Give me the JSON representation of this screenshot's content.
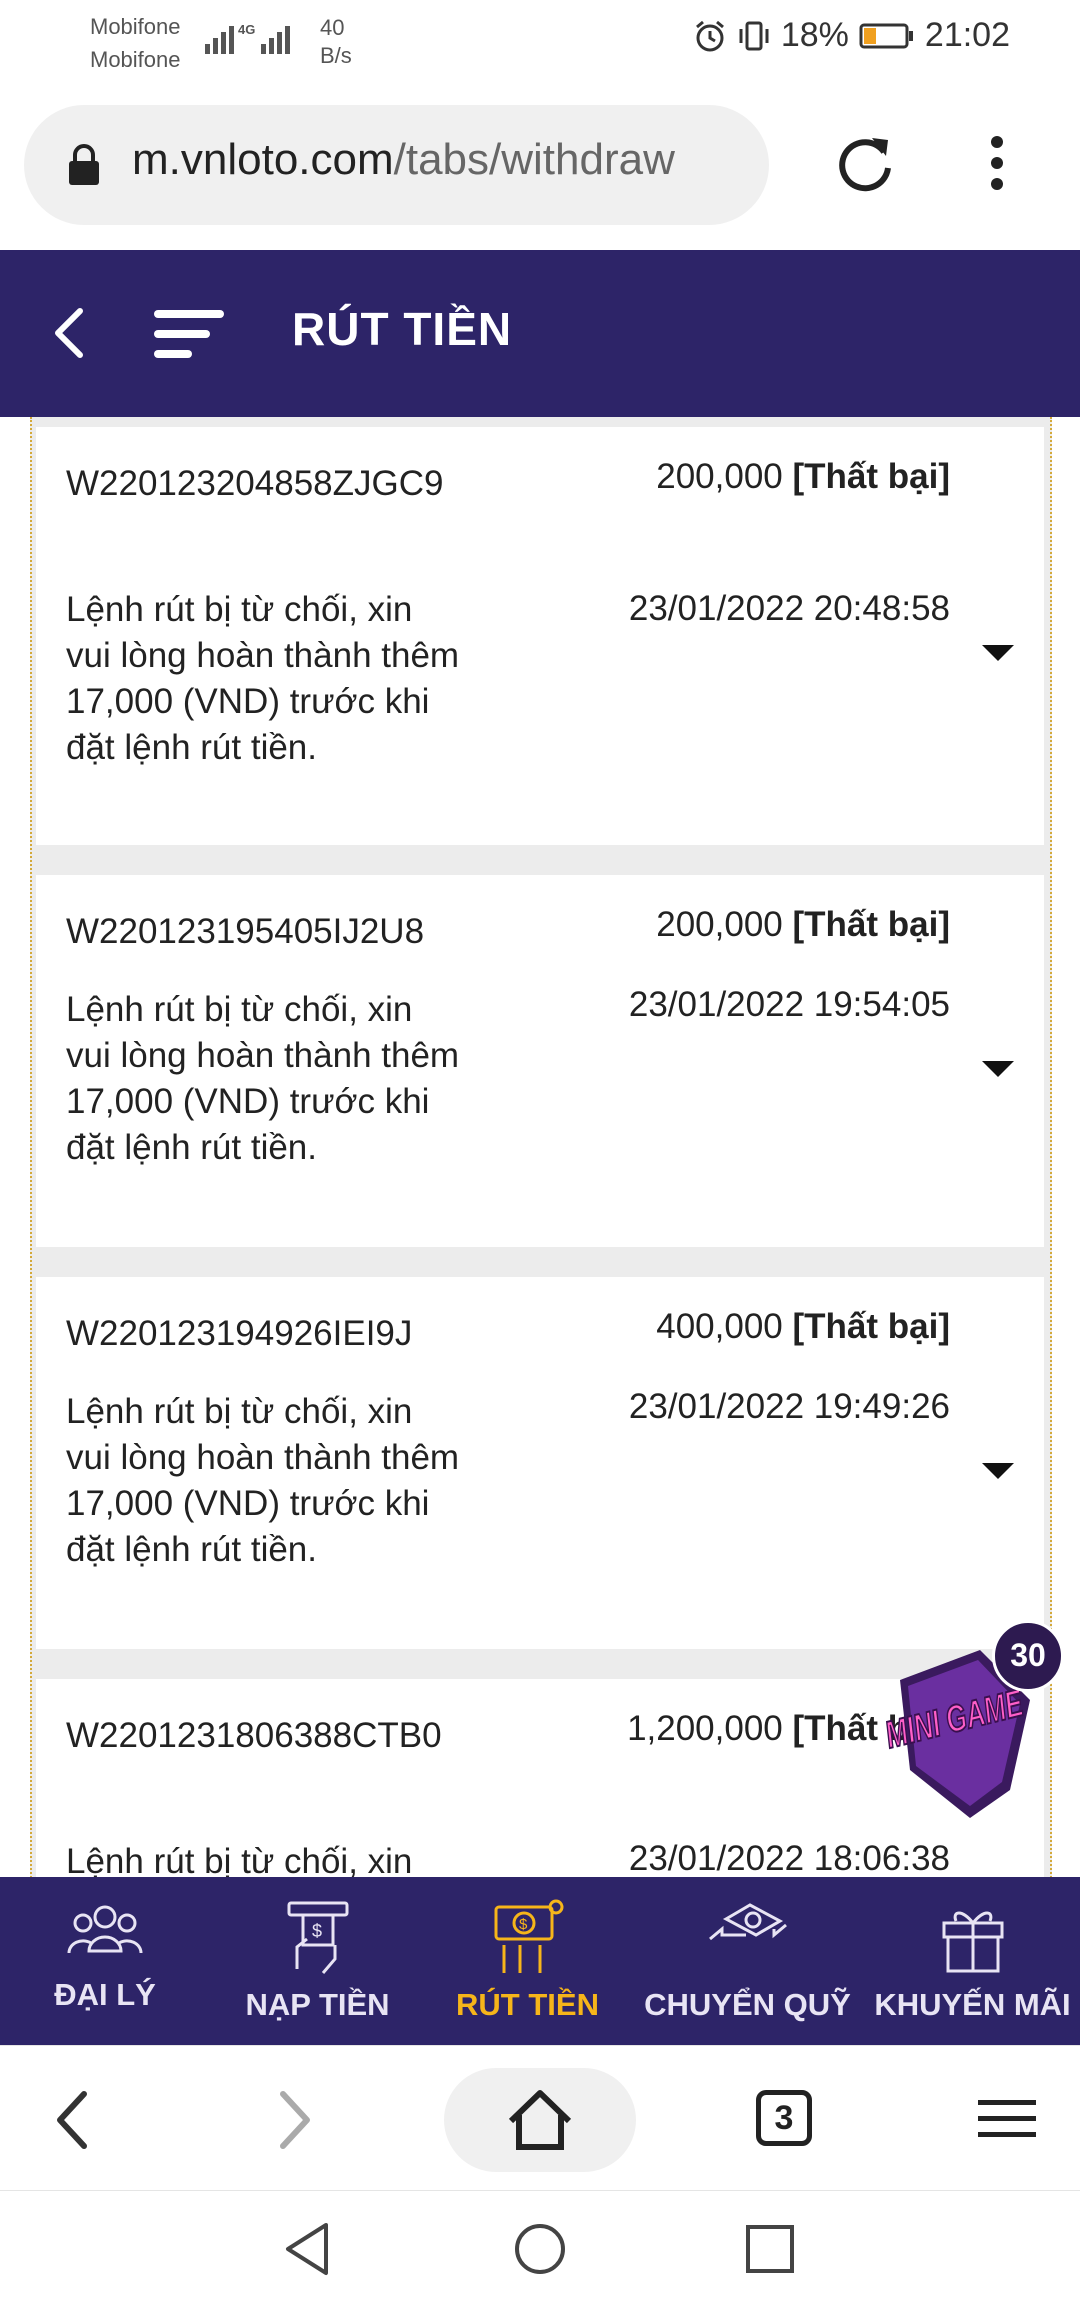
{
  "status_bar": {
    "carrier_1": "Mobifone",
    "carrier_2": "Mobifone",
    "net_speed_value": "40",
    "net_speed_unit": "B/s",
    "battery": "18%",
    "time": "21:02"
  },
  "url_bar": {
    "domain": "m.vnloto.com",
    "path": "/tabs/withdraw"
  },
  "header": {
    "title": "RÚT TIỀN"
  },
  "transactions": [
    {
      "id": "W220123204858ZJGC9",
      "amount": "200,000",
      "status": "[Thất bại]",
      "message": "Lệnh rút bị từ chối, xin vui lòng hoàn thành thêm 17,000 (VND) trước khi đặt lệnh rút tiền.",
      "datetime": "23/01/2022 20:48:58"
    },
    {
      "id": "W220123195405IJ2U8",
      "amount": "200,000",
      "status": "[Thất bại]",
      "message": "Lệnh rút bị từ chối, xin vui lòng hoàn thành thêm 17,000 (VND) trước khi đặt lệnh rút tiền.",
      "datetime": "23/01/2022 19:54:05"
    },
    {
      "id": "W220123194926IEI9J",
      "amount": "400,000",
      "status": "[Thất bại]",
      "message": "Lệnh rút bị từ chối, xin vui lòng hoàn thành thêm 17,000 (VND) trước khi đặt lệnh rút tiền.",
      "datetime": "23/01/2022 19:49:26"
    },
    {
      "id": "W2201231806388CTB0",
      "amount": "1,200,000",
      "status": "[Thất bại]",
      "message": "Lệnh rút bị từ chối, xin",
      "datetime": "23/01/2022 18:06:38"
    }
  ],
  "minigame": {
    "badge_count": "30",
    "logo_text": "MINI GAME"
  },
  "bottom_nav": [
    {
      "label": "ĐẠI LÝ",
      "icon": "people-icon",
      "active": false
    },
    {
      "label": "NẠP TIỀN",
      "icon": "atm-deposit-icon",
      "active": false
    },
    {
      "label": "RÚT TIỀN",
      "icon": "cash-withdraw-icon",
      "active": true
    },
    {
      "label": "CHUYỂN QUỸ",
      "icon": "money-transfer-icon",
      "active": false
    },
    {
      "label": "KHUYẾN MÃI",
      "icon": "gift-icon",
      "active": false
    }
  ],
  "browser": {
    "tab_count": "3"
  },
  "colors": {
    "primary": "#2d2468",
    "active": "#f6b51a",
    "frame_border": "#d4a93a"
  }
}
